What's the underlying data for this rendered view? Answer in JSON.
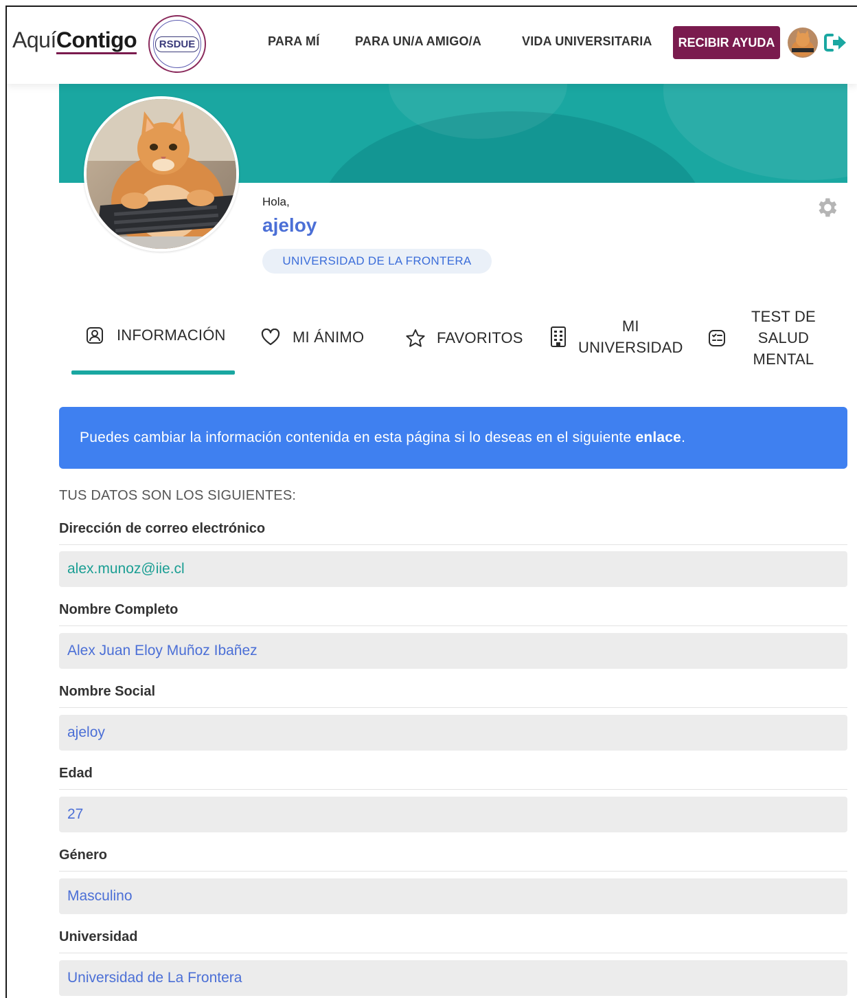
{
  "brand": {
    "part1": "Aquí",
    "part2": "Contigo",
    "seal_text": "RSDUE"
  },
  "nav": {
    "links": [
      "PARA MÍ",
      "PARA UN/A AMIGO/A",
      "VIDA UNIVERSITARIA"
    ],
    "help_button": "RECIBIR AYUDA",
    "avatar_icon": "user-avatar",
    "logout_icon": "logout-icon"
  },
  "profile": {
    "greeting": "Hola,",
    "username": "ajeloy",
    "university_badge": "UNIVERSIDAD DE LA FRONTERA",
    "settings_icon": "gear-icon"
  },
  "tabs": [
    {
      "label": "INFORMACIÓN",
      "icon": "user-square-icon",
      "active": true
    },
    {
      "label": "MI ÁNIMO",
      "icon": "heart-icon",
      "active": false
    },
    {
      "label": "FAVORITOS",
      "icon": "star-icon",
      "active": false
    },
    {
      "label_lines": [
        "MI",
        "UNIVERSIDAD"
      ],
      "icon": "building-icon",
      "active": false
    },
    {
      "label_lines": [
        "TEST DE",
        "SALUD",
        "MENTAL"
      ],
      "icon": "checklist-icon",
      "active": false
    }
  ],
  "alert": {
    "text": "Puedes cambiar la información contenida en esta página si lo deseas en el siguiente ",
    "link": "enlace",
    "suffix": "."
  },
  "section_title": "TUS DATOS SON LOS SIGUIENTES:",
  "fields": [
    {
      "label": "Dirección de correo electrónico",
      "value": "alex.munoz@iie.cl"
    },
    {
      "label": "Nombre Completo",
      "value": "Alex Juan Eloy Muñoz Ibañez"
    },
    {
      "label": "Nombre Social",
      "value": "ajeloy"
    },
    {
      "label": "Edad",
      "value": "27"
    },
    {
      "label": "Género",
      "value": "Masculino"
    },
    {
      "label": "Universidad",
      "value": "Universidad de La Frontera"
    }
  ],
  "colors": {
    "accent": "#1aa7a1",
    "brand": "#7a1b4e",
    "alert": "#3f80f0",
    "link": "#4b6fd6"
  }
}
